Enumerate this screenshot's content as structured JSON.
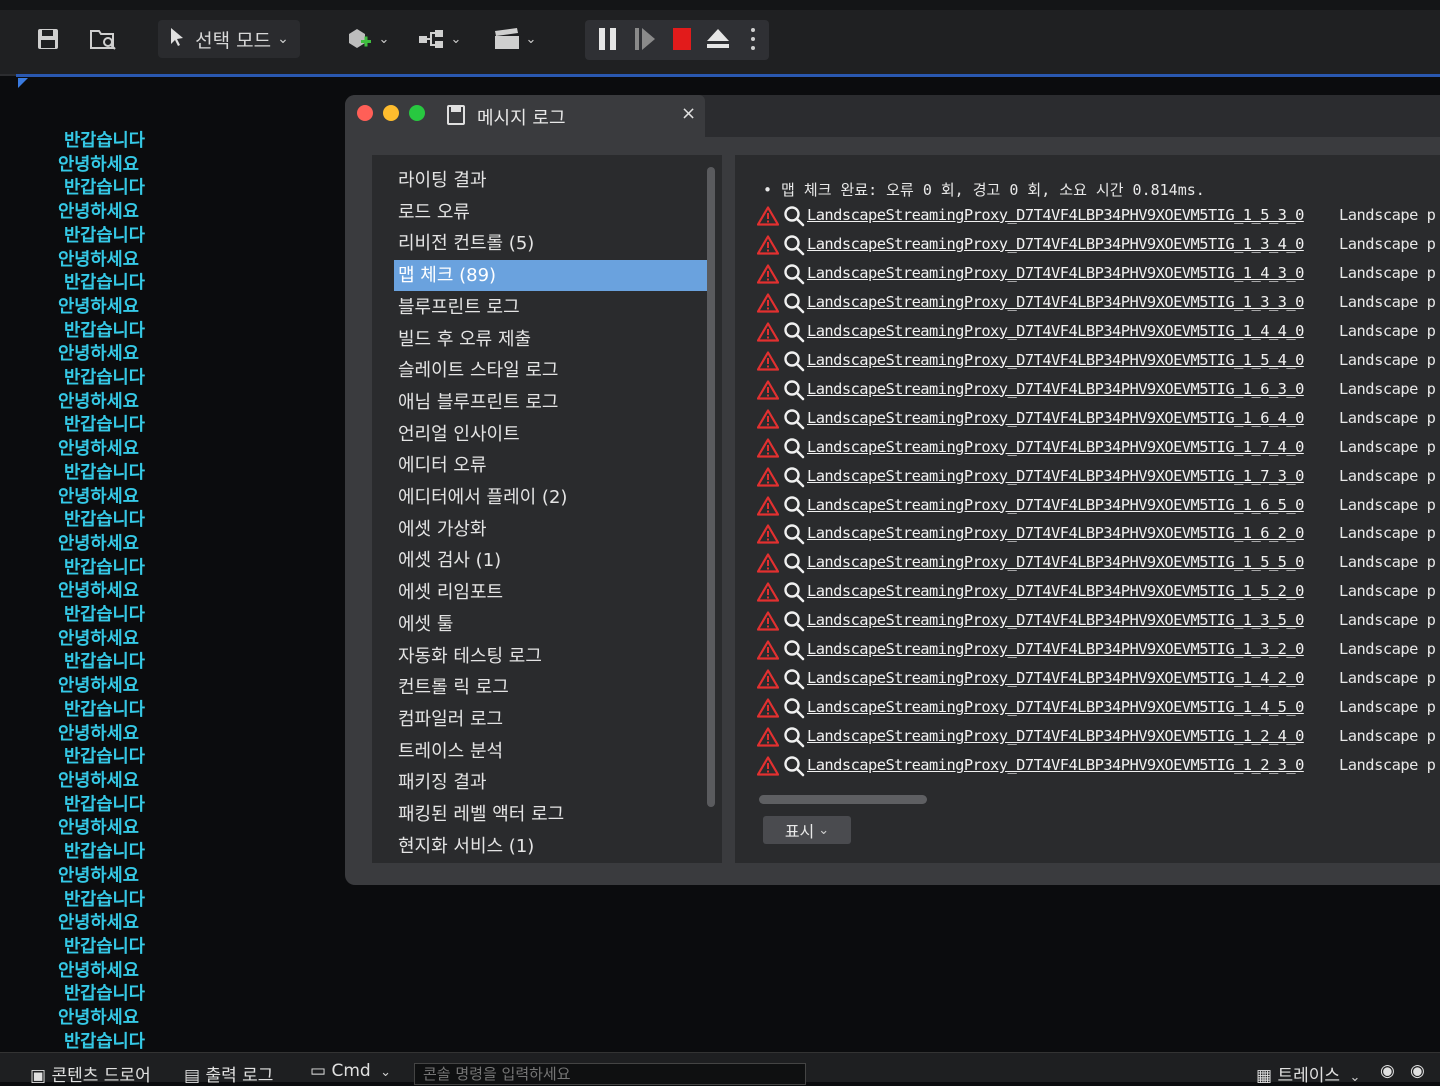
{
  "toolbar": {
    "mode_label": "선택 모드",
    "icons": [
      "save-icon",
      "content-browser-icon",
      "add-actor-icon",
      "blueprint-icon",
      "cinematics-icon",
      "pause-icon",
      "step-icon",
      "stop-icon",
      "eject-icon",
      "more-icon"
    ]
  },
  "console_lines": [
    "반갑습니다",
    "안녕하세요",
    "반갑습니다",
    "안녕하세요",
    "반갑습니다",
    "안녕하세요",
    "반갑습니다",
    "안녕하세요",
    "반갑습니다",
    "안녕하세요",
    "반갑습니다",
    "안녕하세요",
    "반갑습니다",
    "안녕하세요",
    "반갑습니다",
    "안녕하세요",
    "반갑습니다",
    "안녕하세요",
    "반갑습니다",
    "안녕하세요",
    "반갑습니다",
    "안녕하세요",
    "반갑습니다",
    "안녕하세요",
    "반갑습니다",
    "안녕하세요",
    "반갑습니다",
    "안녕하세요",
    "반갑습니다",
    "안녕하세요",
    "반갑습니다",
    "안녕하세요",
    "반갑습니다",
    "안녕하세요",
    "반갑습니다",
    "안녕하세요",
    "반갑습니다",
    "안녕하세요",
    "반갑습니다"
  ],
  "window": {
    "tab_title": "메시지 로그",
    "close_glyph": "×",
    "colors": {
      "close": "#ff5f57",
      "minimize": "#febc2e",
      "maximize": "#28c840",
      "selected": "#6aa2de"
    }
  },
  "categories": [
    {
      "label": "라이팅 결과",
      "selected": false
    },
    {
      "label": "로드 오류",
      "selected": false
    },
    {
      "label": "리비전 컨트롤 (5)",
      "selected": false
    },
    {
      "label": "맵 체크 (89)",
      "selected": true
    },
    {
      "label": "블루프린트 로그",
      "selected": false
    },
    {
      "label": "빌드 후 오류 제출",
      "selected": false
    },
    {
      "label": "슬레이트 스타일 로그",
      "selected": false
    },
    {
      "label": "애님 블루프린트 로그",
      "selected": false
    },
    {
      "label": "언리얼 인사이트",
      "selected": false
    },
    {
      "label": "에디터 오류",
      "selected": false
    },
    {
      "label": "에디터에서 플레이 (2)",
      "selected": false
    },
    {
      "label": "에셋 가상화",
      "selected": false
    },
    {
      "label": "에셋 검사 (1)",
      "selected": false
    },
    {
      "label": "에셋 리임포트",
      "selected": false
    },
    {
      "label": "에셋 툴",
      "selected": false
    },
    {
      "label": "자동화 테스팅 로그",
      "selected": false
    },
    {
      "label": "컨트롤 릭 로그",
      "selected": false
    },
    {
      "label": "컴파일러 로그",
      "selected": false
    },
    {
      "label": "트레이스 분석",
      "selected": false
    },
    {
      "label": "패키징 결과",
      "selected": false
    },
    {
      "label": "패킹된 레벨 액터 로그",
      "selected": false
    },
    {
      "label": "현지화 서비스 (1)",
      "selected": false
    }
  ],
  "log": {
    "summary": "• 맵 체크 완료: 오류 0 회, 경고 0 회, 소요 시간 0.814ms.",
    "rows": [
      {
        "link": "LandscapeStreamingProxy_D7T4VF4LBP34PHV9XOEVM5TIG_1_5_3_0",
        "tail": "Landscape p"
      },
      {
        "link": "LandscapeStreamingProxy_D7T4VF4LBP34PHV9XOEVM5TIG_1_3_4_0",
        "tail": "Landscape p"
      },
      {
        "link": "LandscapeStreamingProxy_D7T4VF4LBP34PHV9XOEVM5TIG_1_4_3_0",
        "tail": "Landscape p"
      },
      {
        "link": "LandscapeStreamingProxy_D7T4VF4LBP34PHV9XOEVM5TIG_1_3_3_0",
        "tail": "Landscape p"
      },
      {
        "link": "LandscapeStreamingProxy_D7T4VF4LBP34PHV9XOEVM5TIG_1_4_4_0",
        "tail": "Landscape p"
      },
      {
        "link": "LandscapeStreamingProxy_D7T4VF4LBP34PHV9XOEVM5TIG_1_5_4_0",
        "tail": "Landscape p"
      },
      {
        "link": "LandscapeStreamingProxy_D7T4VF4LBP34PHV9XOEVM5TIG_1_6_3_0",
        "tail": "Landscape p"
      },
      {
        "link": "LandscapeStreamingProxy_D7T4VF4LBP34PHV9XOEVM5TIG_1_6_4_0",
        "tail": "Landscape p"
      },
      {
        "link": "LandscapeStreamingProxy_D7T4VF4LBP34PHV9XOEVM5TIG_1_7_4_0",
        "tail": "Landscape p"
      },
      {
        "link": "LandscapeStreamingProxy_D7T4VF4LBP34PHV9XOEVM5TIG_1_7_3_0",
        "tail": "Landscape p"
      },
      {
        "link": "LandscapeStreamingProxy_D7T4VF4LBP34PHV9XOEVM5TIG_1_6_5_0",
        "tail": "Landscape p"
      },
      {
        "link": "LandscapeStreamingProxy_D7T4VF4LBP34PHV9XOEVM5TIG_1_6_2_0",
        "tail": "Landscape p"
      },
      {
        "link": "LandscapeStreamingProxy_D7T4VF4LBP34PHV9XOEVM5TIG_1_5_5_0",
        "tail": "Landscape p"
      },
      {
        "link": "LandscapeStreamingProxy_D7T4VF4LBP34PHV9XOEVM5TIG_1_5_2_0",
        "tail": "Landscape p"
      },
      {
        "link": "LandscapeStreamingProxy_D7T4VF4LBP34PHV9XOEVM5TIG_1_3_5_0",
        "tail": "Landscape p"
      },
      {
        "link": "LandscapeStreamingProxy_D7T4VF4LBP34PHV9XOEVM5TIG_1_3_2_0",
        "tail": "Landscape p"
      },
      {
        "link": "LandscapeStreamingProxy_D7T4VF4LBP34PHV9XOEVM5TIG_1_4_2_0",
        "tail": "Landscape p"
      },
      {
        "link": "LandscapeStreamingProxy_D7T4VF4LBP34PHV9XOEVM5TIG_1_4_5_0",
        "tail": "Landscape p"
      },
      {
        "link": "LandscapeStreamingProxy_D7T4VF4LBP34PHV9XOEVM5TIG_1_2_4_0",
        "tail": "Landscape p"
      },
      {
        "link": "LandscapeStreamingProxy_D7T4VF4LBP34PHV9XOEVM5TIG_1_2_3_0",
        "tail": "Landscape p"
      }
    ],
    "show_label": "표시"
  },
  "bottombar": {
    "content_drawer": "콘텐츠 드로어",
    "output_log": "출력 로그",
    "cmd": "Cmd",
    "console_placeholder": "콘솔 명령을 입력하세요",
    "trace": "트레이스"
  }
}
